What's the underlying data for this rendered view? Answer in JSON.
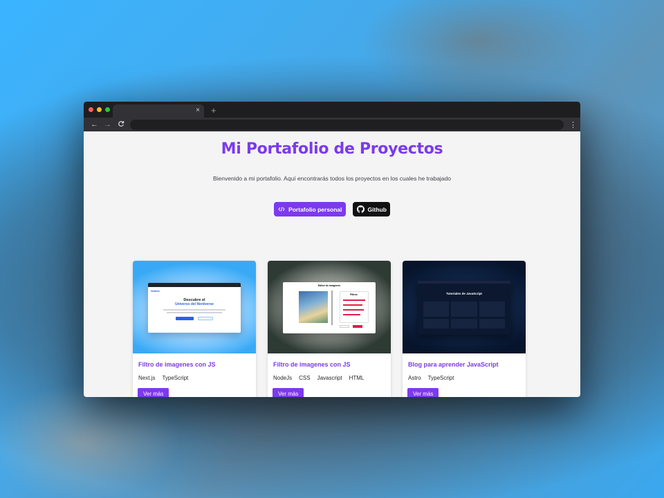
{
  "browser": {
    "dots": [
      "#ff5f57",
      "#febc2e",
      "#28c840"
    ],
    "tab_close": "×",
    "new_tab": "+",
    "back": "←",
    "forward": "→",
    "reload": "C",
    "menu": "⋮"
  },
  "page": {
    "title": "Mi Portafolio de Proyectos",
    "intro": "Bienvenido a mi portafolio. Aquí encontrarás todos los proyectos en los cuales he trabajado",
    "buttons": {
      "portfolio_label": "Portafolio personal",
      "portfolio_icon": "code-icon",
      "github_label": "Github",
      "github_icon": "github-icon"
    },
    "accent": "#7c3aed",
    "projects": [
      {
        "title": "Filtro de imagenes con JS",
        "tags": [
          "Next.js",
          "TypeScript"
        ],
        "cta": "Ver más",
        "preview": {
          "brand": "Venture",
          "heading": "Descubre el",
          "highlight": "Universo del Nerdverse"
        }
      },
      {
        "title": "Filtro de imagenes con JS",
        "tags": [
          "NodeJs",
          "CSS",
          "Javascript",
          "HTML"
        ],
        "cta": "Ver más",
        "preview": {
          "heading": "Editor de imagenes",
          "panel": "Filtros"
        }
      },
      {
        "title": "Blog para aprender JavaScript",
        "tags": [
          "Astro",
          "TypeScript"
        ],
        "cta": "Ver más",
        "preview": {
          "heading": "Tutoriales de JavaScript"
        }
      }
    ]
  }
}
